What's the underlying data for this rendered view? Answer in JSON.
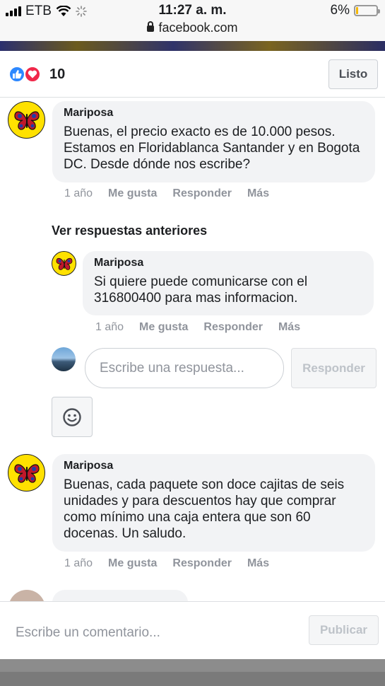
{
  "status_bar": {
    "carrier": "ETB",
    "time": "11:27 a. m.",
    "battery": "6%",
    "battery_level_percent": 6,
    "url": "facebook.com"
  },
  "reactions": {
    "icons": [
      "like-icon",
      "love-icon"
    ],
    "count": "10",
    "done_label": "Listo"
  },
  "comments": [
    {
      "author": "Mariposa",
      "text": "Buenas, el precio exacto es de 10.000 pesos. Estamos en Floridablanca Santander y en Bogota DC. Desde dónde nos escribe?",
      "time": "1 año",
      "like_label": "Me gusta",
      "reply_label": "Responder",
      "more_label": "Más"
    }
  ],
  "view_previous_replies": "Ver respuestas anteriores",
  "reply": {
    "author": "Mariposa",
    "text": "Si quiere puede comunicarse con el 316800400 para mas informacion.",
    "time": "1 año",
    "like_label": "Me gusta",
    "reply_label": "Responder",
    "more_label": "Más"
  },
  "reply_composer": {
    "placeholder": "Escribe una respuesta...",
    "button_label": "Responder"
  },
  "comment2": {
    "author": "Mariposa",
    "text": "Buenas, cada paquete son doce cajitas de seis unidades y para descuentos hay que comprar como mínimo una caja entera que son 60 docenas. Un saludo.",
    "time": "1 año",
    "like_label": "Me gusta",
    "reply_label": "Responder",
    "more_label": "Más"
  },
  "comment_composer": {
    "placeholder": "Escribe un comentario...",
    "button_label": "Publicar"
  },
  "colors": {
    "like_blue": "#2d88ff",
    "love_red": "#f0284a",
    "bubble_gray": "#f2f3f5",
    "meta_gray": "#90949c"
  }
}
